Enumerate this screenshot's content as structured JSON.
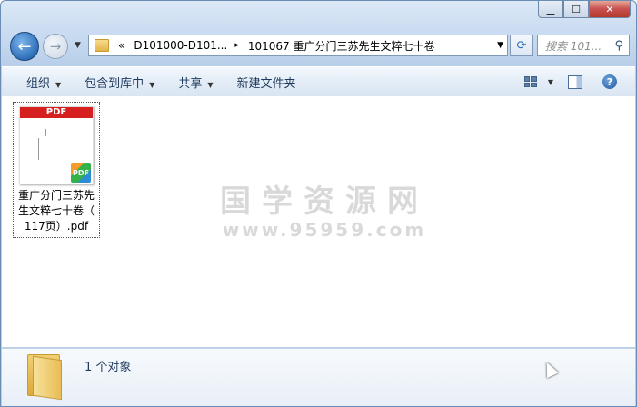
{
  "window": {
    "min_glyph": "▁",
    "max_glyph": "☐",
    "close_glyph": "✕"
  },
  "nav": {
    "back_glyph": "←",
    "forward_glyph": "→",
    "history_dropdown_glyph": "▼",
    "address": {
      "overflow_glyph": "«",
      "crumbs": [
        "D101000-D101...",
        "101067 重广分门三苏先生文粹七十卷"
      ],
      "separator_glyph": "▸",
      "dropdown_glyph": "▼"
    },
    "refresh_glyph": "⟳",
    "search_placeholder": "搜索 101...",
    "search_glyph": "⚲"
  },
  "toolbar": {
    "organize": "组织",
    "include_in_library": "包含到库中",
    "share": "共享",
    "new_folder": "新建文件夹",
    "menu_glyph": "▼",
    "help_glyph": "?"
  },
  "files": [
    {
      "thumb_banner": "PDF",
      "badge": "PDF",
      "name_line1": "重广分门三苏先",
      "name_line2": "生文粹七十卷（",
      "name_line3": "117页）.pdf"
    }
  ],
  "watermark": {
    "line1": "国学资源网",
    "line2": "www.95959.com"
  },
  "details": {
    "count": "1 个对象"
  },
  "colors": {
    "accent": "#2f6fb8",
    "pdf_red": "#d62020",
    "close_red": "#c75050"
  }
}
